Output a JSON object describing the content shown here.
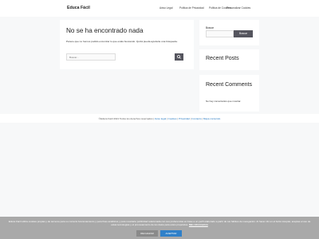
{
  "header": {
    "site_title": "Educa Fácil",
    "nav": [
      "Aviso Legal",
      "Política de Privacidad",
      "Política de Cookies",
      "Personalizar Cookies"
    ]
  },
  "main": {
    "title": "No se ha encontrado nada",
    "message": "Parece que no hemos podido encontrar lo que estás buscando. Quizá pueda ayudarte una búsqueda.",
    "search_placeholder": "Buscar..."
  },
  "sidebar": {
    "search_label": "Buscar",
    "search_button": "Buscar",
    "recent_posts_title": "Recent Posts",
    "recent_comments_title": "Recent Comments",
    "no_comments": "No hay comentarios que mostrar."
  },
  "footer": {
    "copyright": "©Educa Fácil 2021 Todos los derechos reservados |",
    "links": [
      "Aviso legal",
      "Cookies",
      "Privacidad",
      "Contacto",
      "Mapa contenido"
    ],
    "separator": " | "
  },
  "cookie_banner": {
    "text": "Educa Fácil utiliza cookies propias y de terceros para su correcto funcionamiento y para fines analíticos y para mostrarte publicidad relacionada con sus preferencias en base a un perfil elaborado a partir de tus hábitos de navegación. Al hacer clic en el botón Aceptar, aceptas el uso de estas tecnologías y el procesamiento de tus datos para estos propósitos.",
    "more_info": "Más información",
    "reject": "RECHAZAR",
    "accept": "ACEPTAR"
  }
}
